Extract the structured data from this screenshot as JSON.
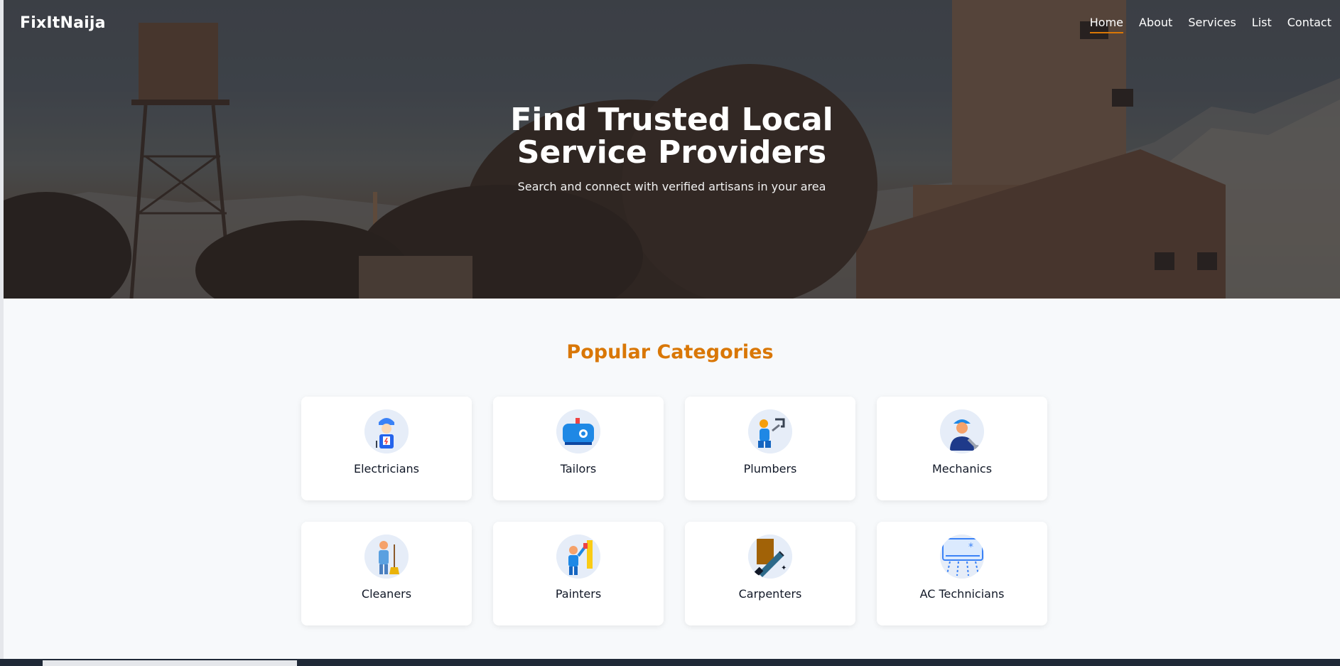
{
  "header": {
    "brand": "FixItNaija",
    "nav": [
      {
        "label": "Home",
        "active": true
      },
      {
        "label": "About"
      },
      {
        "label": "Services"
      },
      {
        "label": "List"
      },
      {
        "label": "Contact"
      }
    ]
  },
  "hero": {
    "title": "Find Trusted Local Service Providers",
    "subtitle": "Search and connect with verified artisans in your area"
  },
  "categories": {
    "title": "Popular Categories",
    "items": [
      {
        "label": "Electricians",
        "icon": "electrician-icon"
      },
      {
        "label": "Tailors",
        "icon": "sewing-machine-icon"
      },
      {
        "label": "Plumbers",
        "icon": "plumber-icon"
      },
      {
        "label": "Mechanics",
        "icon": "mechanic-icon"
      },
      {
        "label": "Cleaners",
        "icon": "cleaner-icon"
      },
      {
        "label": "Painters",
        "icon": "painter-icon"
      },
      {
        "label": "Carpenters",
        "icon": "carpenter-saw-icon"
      },
      {
        "label": "AC Technicians",
        "icon": "air-conditioner-icon"
      }
    ]
  },
  "colors": {
    "accent": "#d97706",
    "card_bg": "#ffffff",
    "page_bg": "#f7f9fb"
  }
}
